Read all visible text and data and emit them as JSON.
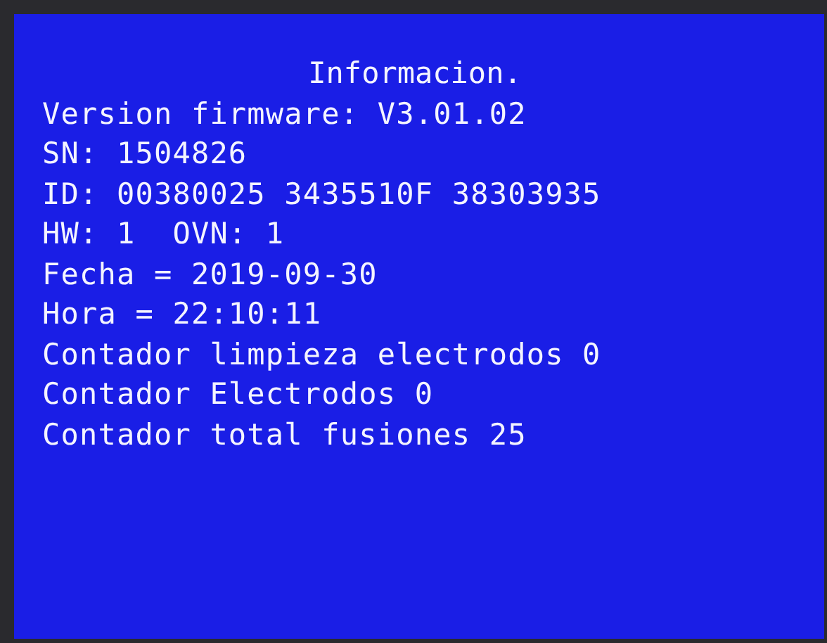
{
  "title": "Informacion.",
  "lines": [
    "Version firmware: V3.01.02",
    "SN: 1504826",
    "ID: 00380025 3435510F 38303935",
    "HW: 1  OVN: 1",
    "Fecha = 2019-09-30",
    "Hora = 22:10:11",
    "Contador limpieza electrodos 0",
    "Contador Electrodos 0",
    "Contador total fusiones 25"
  ]
}
